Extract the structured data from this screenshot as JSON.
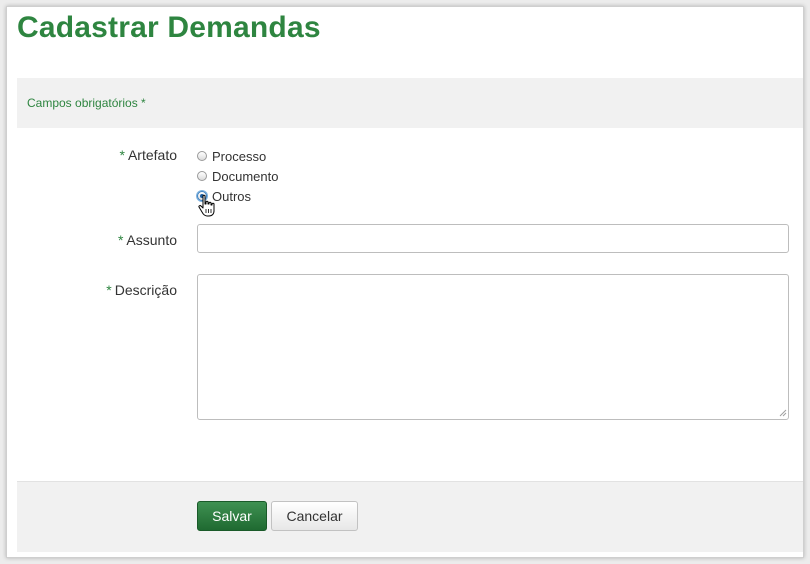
{
  "page": {
    "title": "Cadastrar Demandas",
    "required_note": "Campos obrigatórios *"
  },
  "form": {
    "required_marker": "*",
    "artefato": {
      "label": "Artefato",
      "options": [
        "Processo",
        "Documento",
        "Outros"
      ],
      "selected": "Outros"
    },
    "assunto": {
      "label": "Assunto",
      "value": ""
    },
    "descricao": {
      "label": "Descrição",
      "value": ""
    }
  },
  "actions": {
    "save_label": "Salvar",
    "cancel_label": "Cancelar"
  },
  "colors": {
    "brand_green": "#2e8540",
    "save_button": "#2a7a3b"
  },
  "icons": {
    "cursor": "hand-pointer-icon",
    "resize": "resize-grip-icon"
  }
}
